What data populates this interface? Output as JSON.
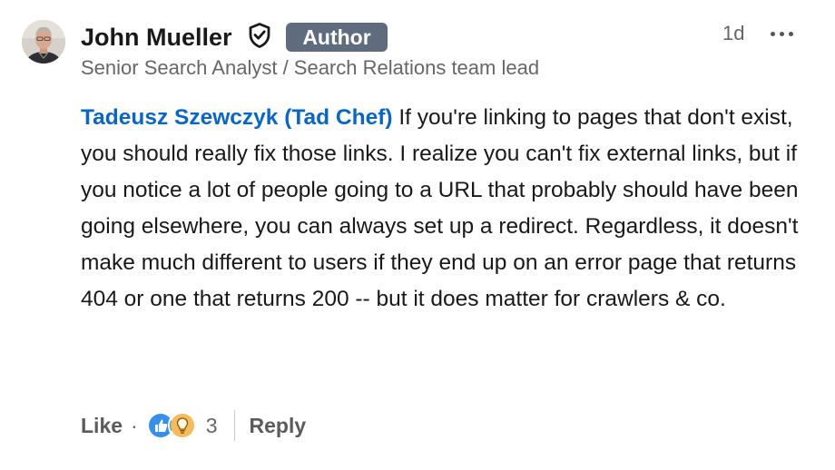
{
  "post": {
    "author": {
      "name": "John Mueller",
      "badge": "Author",
      "headline": "Senior Search Analyst / Search Relations team lead",
      "verified_icon": "shield-check-icon",
      "avatar_icon": "avatar-photo"
    },
    "timestamp": "1d",
    "more_icon": "more-horizontal-icon",
    "comment": {
      "mention": "Tadeusz Szewczyk (Tad Chef)",
      "text": " If you're linking to pages that don't exist, you should really fix those links. I realize you can't fix external links, but if you notice a lot of people going to a URL that probably should have been going elsewhere, you can always set up a redirect. Regardless, it doesn't make much different to users if they end up on an error page that returns 404 or one that returns 200 -- but it does matter for crawlers & co."
    },
    "actions": {
      "like_label": "Like",
      "separator": "·",
      "reaction_icons": [
        "like-reaction-icon",
        "insightful-reaction-icon"
      ],
      "reaction_count": "3",
      "reply_label": "Reply"
    }
  },
  "colors": {
    "mention": "#0a66c2",
    "badge_bg": "#5e6c7e",
    "muted_text": "#666666",
    "like_reaction": "#378fe9",
    "insightful_reaction": "#f5bb5c"
  }
}
